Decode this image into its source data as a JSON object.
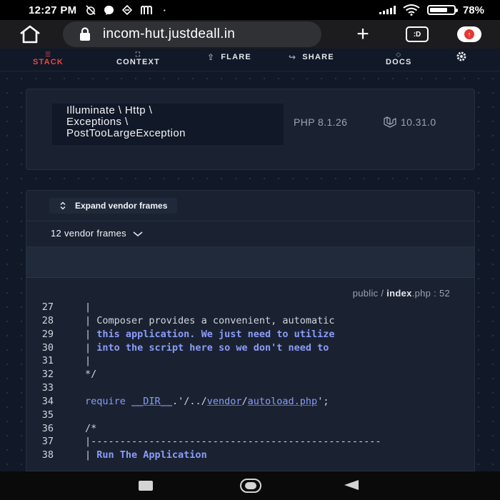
{
  "status_bar": {
    "time": "12:27 PM",
    "left_icons": [
      "no-alarm-icon",
      "messenger-icon",
      "vpn-icon",
      "m-app-icon"
    ],
    "dot": "·",
    "battery": "78%",
    "battery_level": 0.78
  },
  "browser": {
    "url": "incom-hut.justdeall.in",
    "tabs_label": ":D",
    "menu_badge": "↑"
  },
  "nav": {
    "items": [
      {
        "label": "STACK",
        "icon": "stack-icon",
        "active": true
      },
      {
        "label": "CONTEXT",
        "icon": "context-icon",
        "active": false
      },
      {
        "label": "FLARE",
        "icon": "flare-icon",
        "active": false
      },
      {
        "label": "SHARE",
        "icon": "share-icon",
        "active": false
      },
      {
        "label": "DOCS",
        "icon": "laravel-icon",
        "active": false
      }
    ],
    "settings_icon": "gear-icon"
  },
  "exception": {
    "class_lines": [
      "Illuminate \\ Http \\",
      "Exceptions \\",
      "PostTooLargeException"
    ],
    "php_version": "PHP 8.1.26",
    "laravel_version": "10.31.0"
  },
  "frames": {
    "expand_label": "Expand vendor frames",
    "vendor_frames_label": "12 vendor frames",
    "file_dir": "public / ",
    "file_name": "index",
    "file_ext": ".php",
    "file_line": " : 52"
  },
  "code_lines": [
    {
      "n": "27",
      "text": "|"
    },
    {
      "n": "28",
      "text": "| Composer provides a convenient, automatic"
    },
    {
      "n": "29",
      "text": "| this application. We just need to utilize"
    },
    {
      "n": "30",
      "text": "| into the script here so we don't need to"
    },
    {
      "n": "31",
      "text": "|"
    },
    {
      "n": "32",
      "text": "*/"
    },
    {
      "n": "33",
      "text": ""
    },
    {
      "n": "34",
      "text": "require __DIR__.'/../vendor/autoload.php';"
    },
    {
      "n": "35",
      "text": ""
    },
    {
      "n": "36",
      "text": "/*"
    },
    {
      "n": "37",
      "text": "|--------------------------------------------------"
    },
    {
      "n": "38",
      "text": "| Run The Application"
    }
  ]
}
